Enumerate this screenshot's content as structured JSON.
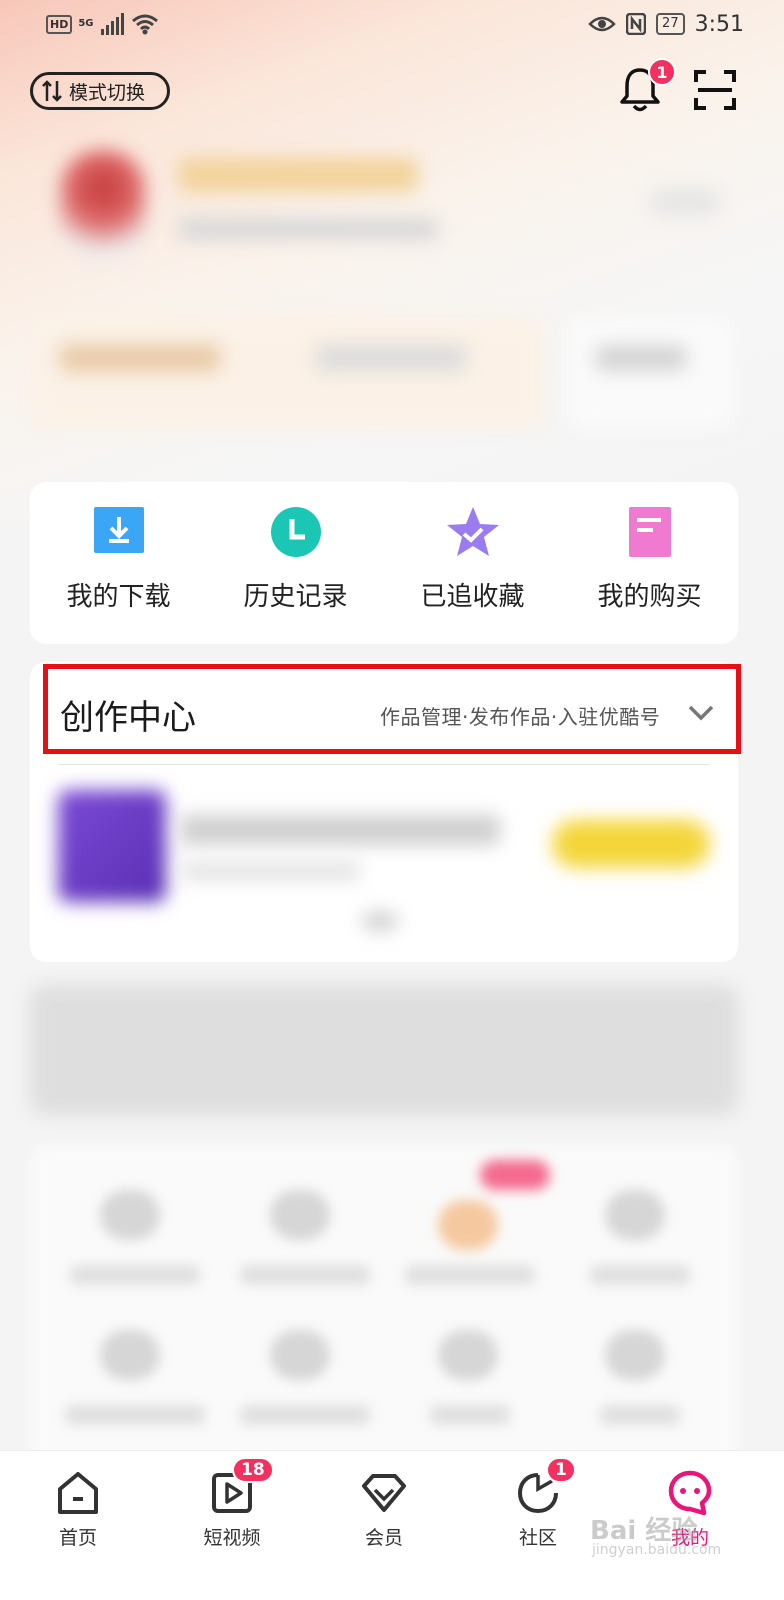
{
  "status_bar": {
    "time": "3:51",
    "battery": "27",
    "hd": "HD",
    "network": "5G"
  },
  "header": {
    "mode_switch_label": "模式切换",
    "notification_count": "1"
  },
  "quick_actions": [
    {
      "label": "我的下载",
      "icon": "download-icon",
      "color": "#3aa6f5"
    },
    {
      "label": "历史记录",
      "icon": "clock-icon",
      "color": "#1cc6b5"
    },
    {
      "label": "已追收藏",
      "icon": "star-icon",
      "color": "#9b7cf0"
    },
    {
      "label": "我的购买",
      "icon": "receipt-icon",
      "color": "#f07ad0"
    }
  ],
  "creator_center": {
    "title": "创作中心",
    "links": "作品管理·发布作品·入驻优酷号"
  },
  "tabbar": {
    "items": [
      {
        "label": "首页",
        "icon": "home-icon"
      },
      {
        "label": "短视频",
        "icon": "play-icon",
        "badge": "18"
      },
      {
        "label": "会员",
        "icon": "diamond-icon"
      },
      {
        "label": "社区",
        "icon": "community-icon",
        "badge": "1"
      },
      {
        "label": "我的",
        "icon": "profile-icon",
        "active": true
      }
    ],
    "active_color": "#e8157a"
  },
  "watermark": {
    "text": "Bai 经验",
    "url": "jingyan.baidu.com"
  }
}
